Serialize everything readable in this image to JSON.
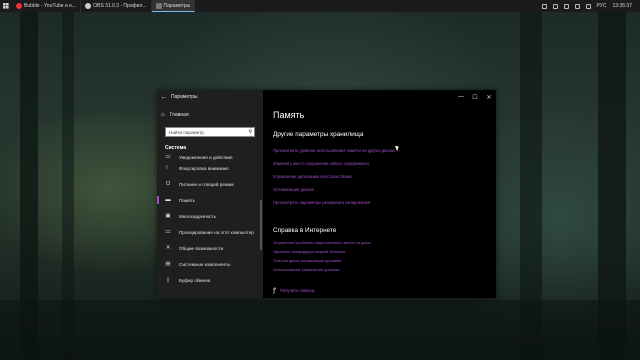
{
  "taskbar": {
    "apps": [
      {
        "label": "Bubble - YouTube и е...",
        "color": "#ff0000",
        "active": false
      },
      {
        "label": "OBS 31.0.3 - Профил...",
        "color": "#d0d0d0",
        "active": false
      },
      {
        "label": "Параметры",
        "color": "#4c4c4c",
        "active": true
      }
    ],
    "tray": {
      "lang": "РУС",
      "time": "13:35:37"
    }
  },
  "window": {
    "title": "Параметры",
    "controls": {
      "minimize": "—",
      "maximize": "☐",
      "close": "✕"
    },
    "back_glyph": "←"
  },
  "sidebar": {
    "home_label": "Главная",
    "search_placeholder": "Найти параметр",
    "section_label": "Система",
    "items": [
      {
        "label": "Уведомления и действия",
        "icon": "notification-icon",
        "glyph": "▭",
        "partial": true
      },
      {
        "label": "Фокусировка внимания",
        "icon": "moon-icon",
        "glyph": "☾"
      },
      {
        "label": "Питание и спящий режим",
        "icon": "power-icon",
        "glyph": "⏻"
      },
      {
        "label": "Память",
        "icon": "storage-icon",
        "glyph": "▬",
        "active": true
      },
      {
        "label": "Многозадачность",
        "icon": "multitasking-icon",
        "glyph": "▣"
      },
      {
        "label": "Проецирование на этот компьютер",
        "icon": "project-icon",
        "glyph": "▭"
      },
      {
        "label": "Общие возможности",
        "icon": "shared-icon",
        "glyph": "✕"
      },
      {
        "label": "Системные компоненты",
        "icon": "components-icon",
        "glyph": "▤"
      },
      {
        "label": "Буфер обмена",
        "icon": "clipboard-icon",
        "glyph": "▯"
      }
    ]
  },
  "content": {
    "title": "Память",
    "storage_heading": "Другие параметры хранилища",
    "storage_links": [
      "Просмотреть уровень использования памяти на других дисках",
      "Изменить место сохранения нового содержимого",
      "Управление дисковыми пространствами",
      "Оптимизация дисков",
      "Просмотреть параметры резервного копирования"
    ],
    "help_heading": "Справка в Интернете",
    "help_links": [
      "Устранение проблемы недостаточного места на диске",
      "Удаление предыдущих версий Windows",
      "Очистка диска оптимизации доставки",
      "Использование управления дисками"
    ],
    "get_help": "Получить помощь"
  },
  "colors": {
    "accent": "#9b52c8",
    "link": "#a04ec4"
  }
}
